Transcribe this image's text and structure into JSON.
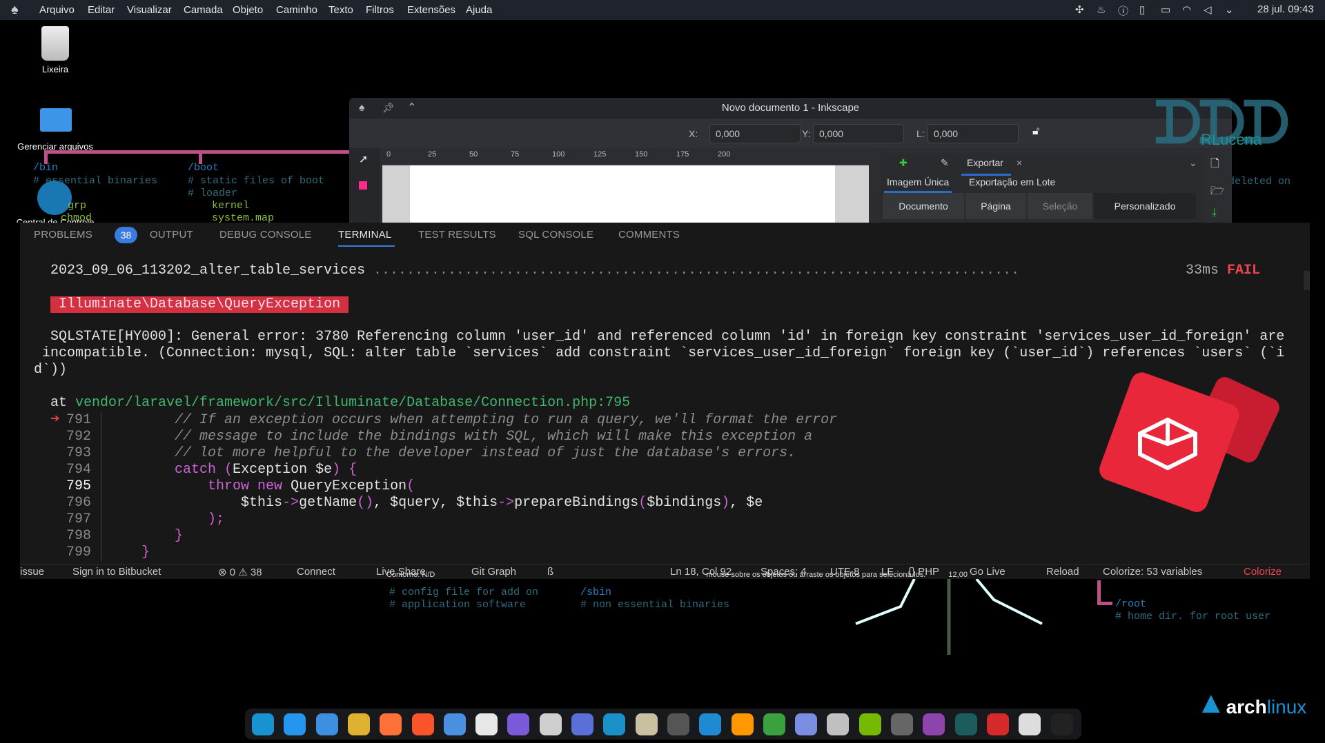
{
  "topbar": {
    "menus": [
      "Arquivo",
      "Editar",
      "Visualizar",
      "Camada",
      "Objeto",
      "Caminho",
      "Texto",
      "Filtros",
      "Extensões",
      "Ajuda"
    ],
    "tray_icons": [
      "slack-icon",
      "flame-icon",
      "info-icon",
      "clipboard-icon",
      "display-icon",
      "wifi-icon",
      "volume-icon",
      "chevron-down-icon"
    ],
    "clock": "28 jul. 09:43"
  },
  "desktop": {
    "icons": [
      {
        "label": "Lixeira",
        "icon": "trash-icon"
      },
      {
        "label": "Gerenciar arquivos",
        "icon": "folder-icon"
      },
      {
        "label": "Central de Controle",
        "icon": "control-center-icon"
      }
    ],
    "wallpaper_text": {
      "bin": "/bin",
      "bin_c": "# essential binaries",
      "boot": "/boot",
      "boot_c1": "# static files of boot",
      "boot_c2": "# loader",
      "kernel": "kernel",
      "sysmap": "system.map",
      "grp": "grp",
      "chmod": "chmod",
      "deleted": "deleted on",
      "opt_c1": "# config file for add on",
      "opt_c2": "# application software",
      "sbin": "/sbin",
      "sbin_c": "# non essential binaries",
      "root": "/root",
      "root_c": "# home dir. for root user"
    },
    "watermark": "RLucena",
    "distro_logo": "archlinux"
  },
  "inkscape": {
    "title": "Novo documento 1 - Inkscape",
    "x_label": "X:",
    "x_value": "0,000",
    "y_label": "Y:",
    "y_value": "0,000",
    "w_label": "L:",
    "w_value": "0,000",
    "ruler": [
      "0",
      "25",
      "50",
      "75",
      "100",
      "125",
      "150",
      "175",
      "200"
    ],
    "export_tab": "Exportar",
    "subtabs": [
      "Imagem Única",
      "Exportação em Lote"
    ],
    "area_buttons": [
      "Documento",
      "Página",
      "Seleção",
      "Personalizado"
    ],
    "status_stroke": "Contorno:",
    "status_stroke_value": "N/D",
    "status_hint": "mouse sobre os objetos ou arraste os objetos para selecioná-los.",
    "status_zoom": "12,00"
  },
  "vscode": {
    "tabs": [
      "PROBLEMS",
      "OUTPUT",
      "DEBUG CONSOLE",
      "TERMINAL",
      "TEST RESULTS",
      "SQL CONSOLE",
      "COMMENTS"
    ],
    "active_tab": "TERMINAL",
    "problems_count": "38",
    "terminal": {
      "migration": "2023_09_06_113202_alter_table_services",
      "dots": "..............................................................................",
      "duration": "33ms",
      "result": "FAIL",
      "exception": "Illuminate\\Database\\QueryException",
      "error_lines": [
        "  SQLSTATE[HY000]: General error: 3780 Referencing column 'user_id' and referenced column 'id' in foreign key constraint 'services_user_id_foreign' are",
        " incompatible. (Connection: mysql, SQL: alter table `services` add constraint `services_user_id_foreign` foreign key (`user_id`) references `users` (`i",
        "d`))"
      ],
      "at_label": "at",
      "at_path": "vendor/laravel/framework/src/Illuminate/Database/Connection.php:795",
      "current_line": "795",
      "code": [
        {
          "n": "791",
          "tokens": [
            [
              "        ",
              "txt"
            ],
            [
              "// If an exception occurs when attempting to run a query, we'll format the error",
              "com"
            ]
          ]
        },
        {
          "n": "792",
          "tokens": [
            [
              "        ",
              "txt"
            ],
            [
              "// message to include the bindings with SQL, which will make this exception a",
              "com"
            ]
          ]
        },
        {
          "n": "793",
          "tokens": [
            [
              "        ",
              "txt"
            ],
            [
              "// lot more helpful to the developer instead of just the database's errors.",
              "com"
            ]
          ]
        },
        {
          "n": "794",
          "tokens": [
            [
              "        ",
              "txt"
            ],
            [
              "catch",
              "kw"
            ],
            [
              " ",
              "txt"
            ],
            [
              "(",
              "pun"
            ],
            [
              "Exception $e",
              "txt"
            ],
            [
              ")",
              "pun"
            ],
            [
              " ",
              "txt"
            ],
            [
              "{",
              "pun"
            ]
          ]
        },
        {
          "n": "795",
          "tokens": [
            [
              "            ",
              "txt"
            ],
            [
              "throw new",
              "kw"
            ],
            [
              " QueryException",
              "txt"
            ],
            [
              "(",
              "pun"
            ]
          ]
        },
        {
          "n": "796",
          "tokens": [
            [
              "                ",
              "txt"
            ],
            [
              "$this",
              "txt"
            ],
            [
              "->",
              "pun"
            ],
            [
              "getName",
              "txt"
            ],
            [
              "()",
              "pun"
            ],
            [
              ", $query, ",
              "txt"
            ],
            [
              "$this",
              "txt"
            ],
            [
              "->",
              "pun"
            ],
            [
              "prepareBindings",
              "txt"
            ],
            [
              "(",
              "pun"
            ],
            [
              "$bindings",
              "txt"
            ],
            [
              ")",
              "pun"
            ],
            [
              ", $e",
              "txt"
            ]
          ]
        },
        {
          "n": "797",
          "tokens": [
            [
              "            ",
              "txt"
            ],
            [
              ");",
              "pun"
            ]
          ]
        },
        {
          "n": "798",
          "tokens": [
            [
              "        ",
              "txt"
            ],
            [
              "}",
              "pun"
            ]
          ]
        },
        {
          "n": "799",
          "tokens": [
            [
              "    ",
              "txt"
            ],
            [
              "}",
              "pun"
            ]
          ]
        }
      ]
    },
    "status_left": [
      "issue",
      "Sign in to Bitbucket",
      "⊗ 0 ⚠ 38",
      "Connect",
      "Live Share",
      "Git Graph",
      "ß"
    ],
    "status_right": [
      "Ln 18, Col 92",
      "Spaces: 4",
      "UTF-8",
      "LF",
      "{} PHP",
      "Go Live",
      "Reload",
      "Colorize: 53 variables",
      "Colorize"
    ]
  },
  "dock": {
    "apps": [
      {
        "name": "arch-launcher",
        "color": "#1793d1"
      },
      {
        "name": "docker",
        "color": "#2496ed"
      },
      {
        "name": "files",
        "color": "#3d8fe0"
      },
      {
        "name": "chrome",
        "color": "#e0b030"
      },
      {
        "name": "firefox",
        "color": "#ff7139"
      },
      {
        "name": "brave",
        "color": "#fb542b"
      },
      {
        "name": "thunderbird",
        "color": "#4a8fe0"
      },
      {
        "name": "slack",
        "color": "#e8e8e8"
      },
      {
        "name": "notes",
        "color": "#7a5ad8"
      },
      {
        "name": "system-monitor",
        "color": "#cfcfcf"
      },
      {
        "name": "control-center",
        "color": "#5b6fd8"
      },
      {
        "name": "settings",
        "color": "#1a8fc8"
      },
      {
        "name": "tux",
        "color": "#c8c0a0"
      },
      {
        "name": "terminal",
        "color": "#555555"
      },
      {
        "name": "vscode",
        "color": "#1f8ad2"
      },
      {
        "name": "sublime",
        "color": "#ff9800"
      },
      {
        "name": "hs",
        "color": "#3aa040"
      },
      {
        "name": "text-editor",
        "color": "#7a8de0"
      },
      {
        "name": "thermometer",
        "color": "#c0c0c0"
      },
      {
        "name": "nvidia",
        "color": "#76b900"
      },
      {
        "name": "inkscape",
        "color": "#666666"
      },
      {
        "name": "obs",
        "color": "#8e44ad"
      },
      {
        "name": "gitkraken",
        "color": "#1c5c5c"
      },
      {
        "name": "filezilla",
        "color": "#d42a2a"
      },
      {
        "name": "trash",
        "color": "#dddddd"
      },
      {
        "name": "power",
        "color": "#222222"
      }
    ]
  },
  "colors": {
    "fail": "#f0454f",
    "exception_bg": "#d33040",
    "accent": "#3a7be0",
    "laravel": "#e8283a"
  }
}
